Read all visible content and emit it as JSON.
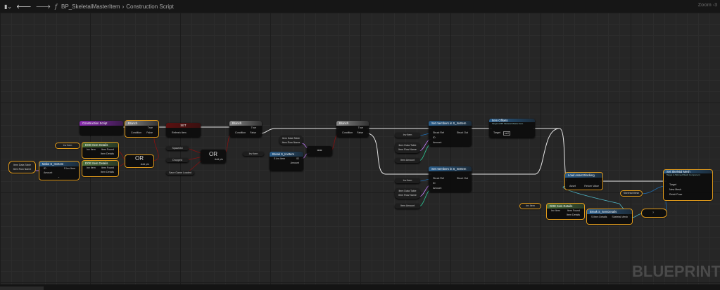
{
  "topbar": {
    "breadcrumb_root": "BP_SkeletalMasterItem",
    "breadcrumb_current": "Construction Script",
    "zoom": "Zoom -3"
  },
  "watermark": "BLUEPRINT",
  "colors": {
    "selection": "#e09a1b",
    "exec_wire": "#e6e6e6",
    "bool_wire": "#8a1010",
    "struct_wire": "#1f6fb5",
    "name_wire": "#c77dff",
    "int_wire": "#2ecc9a",
    "object_wire": "#4fb4c4"
  },
  "nodes": {
    "construction": {
      "title": "Construction Script"
    },
    "branch1": {
      "title": "Branch",
      "cond": "Condition",
      "t": "True",
      "f": "False"
    },
    "set": {
      "title": "SET",
      "pin": "Refresh Item"
    },
    "branch2": {
      "title": "Branch",
      "cond": "Condition",
      "t": "True",
      "f": "False"
    },
    "branch3": {
      "title": "Branch",
      "cond": "Condition",
      "t": "True",
      "f": "False"
    },
    "doe1": {
      "title": "DOE Item Details",
      "in": "Inv Item",
      "found": "Item Found",
      "details": "Item Details"
    },
    "doe2": {
      "title": "DOE Item Details",
      "in": "Inv Item",
      "found": "Item Found",
      "details": "Item Details"
    },
    "doe3": {
      "title": "DOE Item Details",
      "in": "Inv Item",
      "found": "Item Found",
      "details": "Item Details"
    },
    "make": {
      "title": "Make S_InvItem",
      "id": "ID",
      "amount": "Amount",
      "out": "S Inv Item"
    },
    "or1": {
      "title": "OR",
      "add": "Add pin"
    },
    "or2": {
      "title": "OR",
      "add": "Add pin"
    },
    "break_inv": {
      "title": "Break S_InvItem",
      "in": "S Inv Item",
      "id": "ID",
      "amount": "Amount"
    },
    "equal": {
      "title": "=="
    },
    "setm1": {
      "title": "Set members in S_InvItem",
      "ref": "Struct Ref",
      "id": "ID",
      "amount": "Amount",
      "out": "Struct Out"
    },
    "setm2": {
      "title": "Set members in S_InvItem",
      "ref": "Struct Ref",
      "id": "ID",
      "amount": "Amount",
      "out": "Struct Out"
    },
    "offsets": {
      "title": "Item Offsets",
      "subtitle": "Target is BP Skeletal Master Item",
      "target": "Target",
      "self": "self"
    },
    "load": {
      "title": "Load Asset Blocking",
      "asset": "Asset",
      "ret": "Return Value"
    },
    "setmesh": {
      "title": "Set Skeletal Mesh",
      "subtitle": "Target is Skinned Mesh Component",
      "target": "Target",
      "mesh": "New Mesh",
      "reinit": "Reinit Pose"
    },
    "break_det": {
      "title": "Break S_ItemDetails",
      "in": "S Item Details",
      "mesh": "Skeletal Mesh"
    },
    "isvalid": {
      "title": "?"
    }
  },
  "vars": {
    "inv_item": "Inv Item",
    "item_data_table": "Item Data Table",
    "item_row_name": "Item Row Name",
    "spawned": "Spawned",
    "dropped": "Dropped",
    "save_game_loaded": "Save Game Loaded",
    "item_amount": "Item Amount",
    "skeletal_mesh": "Skeletal Mesh"
  }
}
